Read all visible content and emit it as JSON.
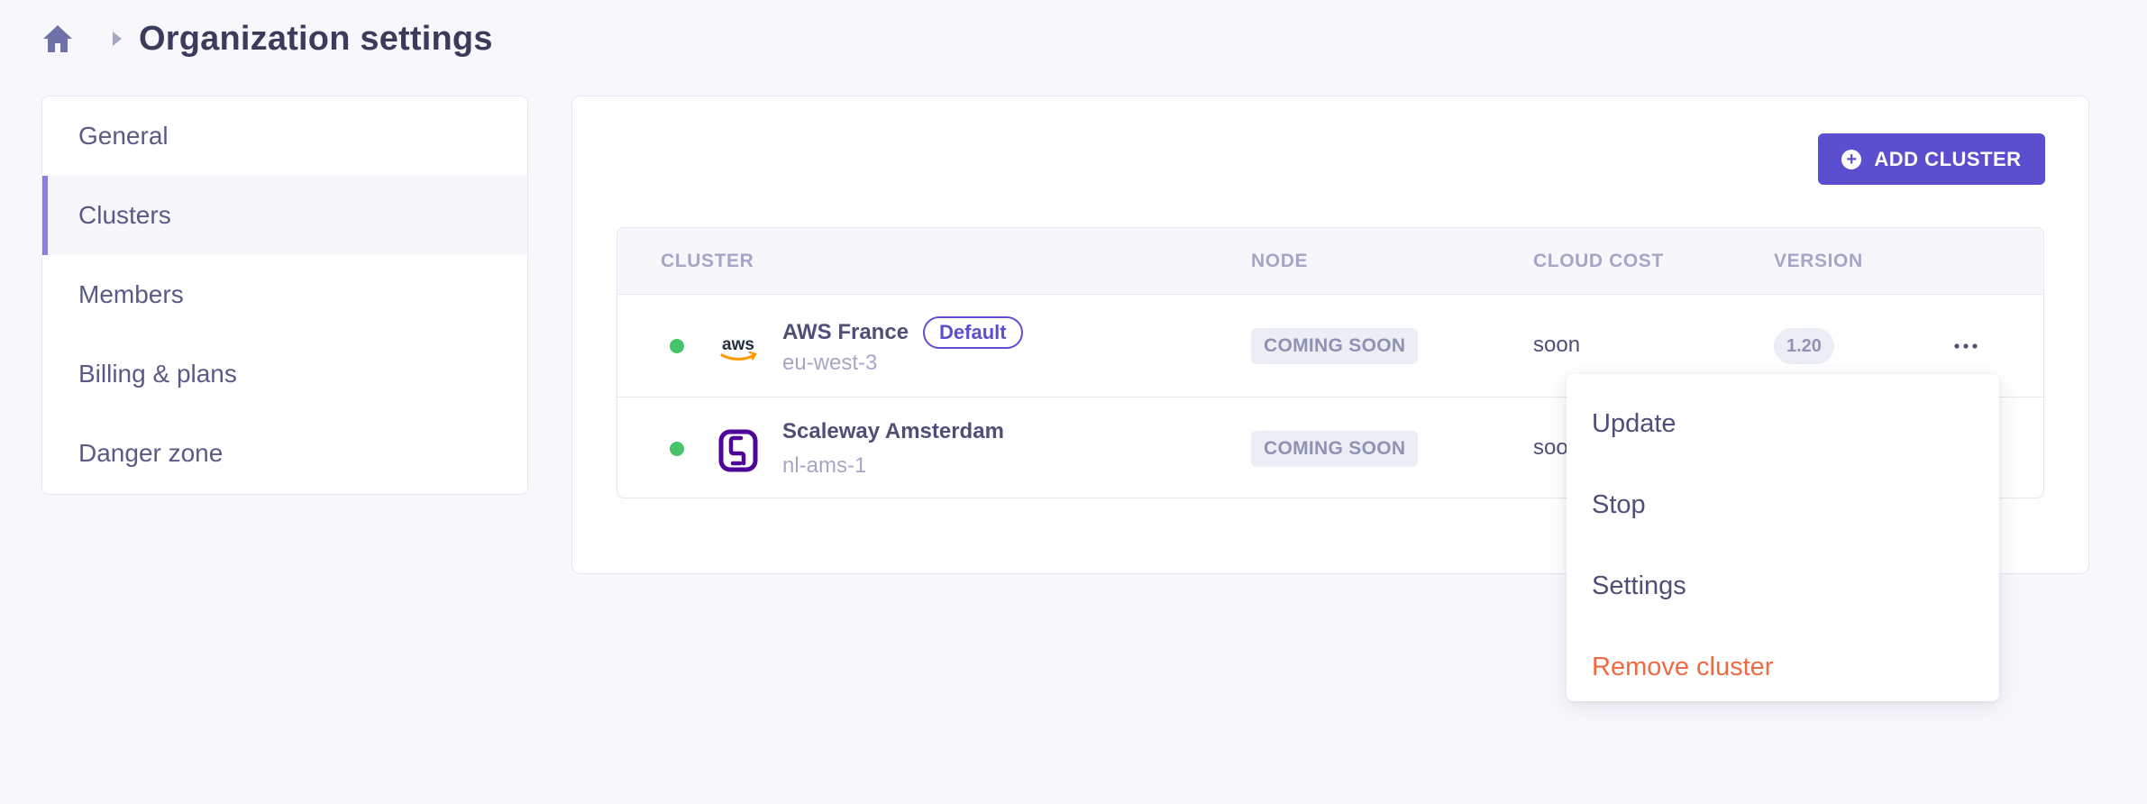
{
  "header": {
    "title": "Organization settings",
    "home_icon": "home-icon",
    "separator_icon": "chevron-right-icon"
  },
  "sidebar": {
    "items": [
      {
        "label": "General",
        "active": false
      },
      {
        "label": "Clusters",
        "active": true
      },
      {
        "label": "Members",
        "active": false
      },
      {
        "label": "Billing & plans",
        "active": false
      },
      {
        "label": "Danger zone",
        "active": false
      }
    ]
  },
  "toolbar": {
    "add_cluster_label": "ADD CLUSTER",
    "add_icon": "plus-circle-icon"
  },
  "table": {
    "columns": [
      "CLUSTER",
      "NODE",
      "CLOUD COST",
      "VERSION"
    ],
    "rows": [
      {
        "name": "AWS France",
        "default_badge": "Default",
        "region": "eu-west-3",
        "provider_icon": "aws-logo-icon",
        "node": "COMING SOON",
        "cost": "soon",
        "version": "1.20",
        "status": "running"
      },
      {
        "name": "Scaleway Amsterdam",
        "region": "nl-ams-1",
        "provider_icon": "scaleway-logo-icon",
        "node": "COMING SOON",
        "cost": "soon",
        "status": "running"
      }
    ]
  },
  "menu": {
    "items": [
      "Update",
      "Stop",
      "Settings",
      "Remove cluster"
    ]
  },
  "colors": {
    "accent": "#5b4fcf",
    "status_green": "#46c46a",
    "danger": "#ef6a43",
    "background": "#f8f8fc"
  }
}
